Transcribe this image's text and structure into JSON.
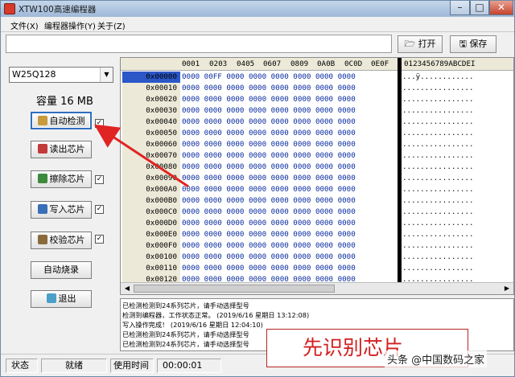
{
  "window": {
    "title": "XTW100高速编程器"
  },
  "menu": [
    "文件(X)",
    "编程器操作(Y)",
    "关于(Z)"
  ],
  "toolbar": {
    "open_label": "打开",
    "save_label": "保存"
  },
  "left": {
    "chip_selected": "W25Q128",
    "capacity": "容量 16 MB",
    "buttons": [
      {
        "label": "自动检测",
        "checked": true
      },
      {
        "label": "读出芯片",
        "checked": false
      },
      {
        "label": "擦除芯片",
        "checked": true
      },
      {
        "label": "写入芯片",
        "checked": true
      },
      {
        "label": "校验芯片",
        "checked": true
      },
      {
        "label": "自动烧录",
        "checked": false
      },
      {
        "label": "退出",
        "checked": false
      }
    ]
  },
  "hex": {
    "header_cols": [
      "0001",
      "0203",
      "0405",
      "0607",
      "0809",
      "0A0B",
      "0C0D",
      "0E0F"
    ],
    "ascii_header": "0123456789ABCDEI",
    "rows": [
      {
        "addr": "0x00000",
        "data": "0000 00FF 0000 0000 0000 0000 0000 0000",
        "ascii": "...ÿ............"
      },
      {
        "addr": "0x00010",
        "data": "0000 0000 0000 0000 0000 0000 0000 0000",
        "ascii": "................"
      },
      {
        "addr": "0x00020",
        "data": "0000 0000 0000 0000 0000 0000 0000 0000",
        "ascii": "................"
      },
      {
        "addr": "0x00030",
        "data": "0000 0000 0000 0000 0000 0000 0000 0000",
        "ascii": "................"
      },
      {
        "addr": "0x00040",
        "data": "0000 0000 0000 0000 0000 0000 0000 0000",
        "ascii": "................"
      },
      {
        "addr": "0x00050",
        "data": "0000 0000 0000 0000 0000 0000 0000 0000",
        "ascii": "................"
      },
      {
        "addr": "0x00060",
        "data": "0000 0000 0000 0000 0000 0000 0000 0000",
        "ascii": "................"
      },
      {
        "addr": "0x00070",
        "data": "0000 0000 0000 0000 0000 0000 0000 0000",
        "ascii": "................"
      },
      {
        "addr": "0x00080",
        "data": "0000 0000 0000 0000 0000 0000 0000 0000",
        "ascii": "................"
      },
      {
        "addr": "0x00090",
        "data": "0000 0000 0000 0000 0000 0000 0000 0000",
        "ascii": "................"
      },
      {
        "addr": "0x000A0",
        "data": "0000 0000 0000 0000 0000 0000 0000 0000",
        "ascii": "................"
      },
      {
        "addr": "0x000B0",
        "data": "0000 0000 0000 0000 0000 0000 0000 0000",
        "ascii": "................"
      },
      {
        "addr": "0x000C0",
        "data": "0000 0000 0000 0000 0000 0000 0000 0000",
        "ascii": "................"
      },
      {
        "addr": "0x000D0",
        "data": "0000 0000 0000 0000 0000 0000 0000 0000",
        "ascii": "................"
      },
      {
        "addr": "0x000E0",
        "data": "0000 0000 0000 0000 0000 0000 0000 0000",
        "ascii": "................"
      },
      {
        "addr": "0x000F0",
        "data": "0000 0000 0000 0000 0000 0000 0000 0000",
        "ascii": "................"
      },
      {
        "addr": "0x00100",
        "data": "0000 0000 0000 0000 0000 0000 0000 0000",
        "ascii": "................"
      },
      {
        "addr": "0x00110",
        "data": "0000 0000 0000 0000 0000 0000 0000 0000",
        "ascii": "................"
      },
      {
        "addr": "0x00120",
        "data": "0000 0000 0000 0000 0000 0000 0000 0000",
        "ascii": "................"
      }
    ]
  },
  "log": [
    "已检测检测到24系列芯片，请手动选择型号",
    "检测到编程器，工作状态正常。 (2019/6/16 星期日 13:12:08)",
    "写入操作完成！ (2019/6/16 星期日 12:04:10)",
    "已检测检测到24系列芯片，请手动选择型号",
    "已检测检测到24系列芯片，请手动选择型号"
  ],
  "overlay_label": "先识别芯片",
  "watermark": "头条 @中国数码之家",
  "status": {
    "label": "状态",
    "value": "就绪",
    "time_label": "使用时间",
    "time_value": "00:00:01"
  },
  "colors": {
    "accent_red": "#d12020",
    "hex_blue": "#0a2da0",
    "selection": "#2b57c7"
  }
}
